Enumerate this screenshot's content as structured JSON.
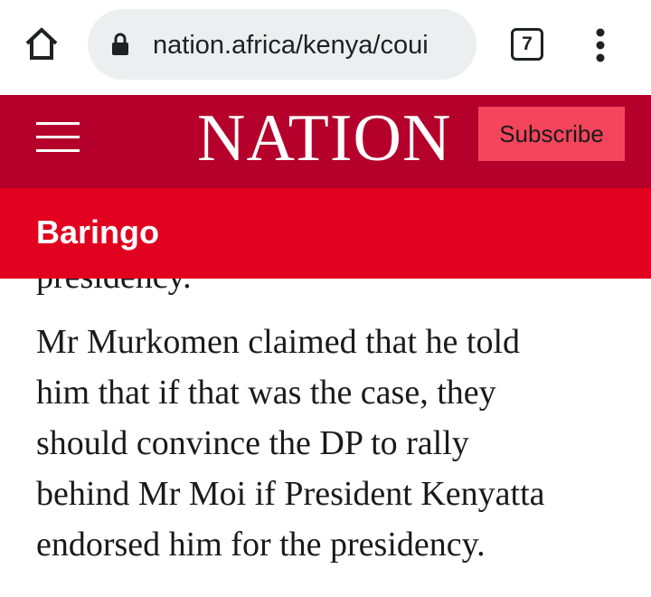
{
  "browser": {
    "url": "nation.africa/kenya/coui",
    "tab_count": "7",
    "icons": {
      "home": "home-icon",
      "lock": "lock-icon",
      "menu": "more-vert-icon"
    }
  },
  "site": {
    "logo": "NATION",
    "subscribe_label": "Subscribe",
    "colors": {
      "header": "#b5002b",
      "section": "#e1001f",
      "subscribe": "#f5455c"
    }
  },
  "section": {
    "title": "Baringo"
  },
  "article": {
    "partial_line": "presidency.",
    "paragraph_lines": [
      "Mr Murkomen claimed that he told",
      "him that if that was the case, they",
      "should convince the DP to rally",
      "behind Mr Moi if President Kenyatta",
      "endorsed him for the presidency."
    ]
  }
}
